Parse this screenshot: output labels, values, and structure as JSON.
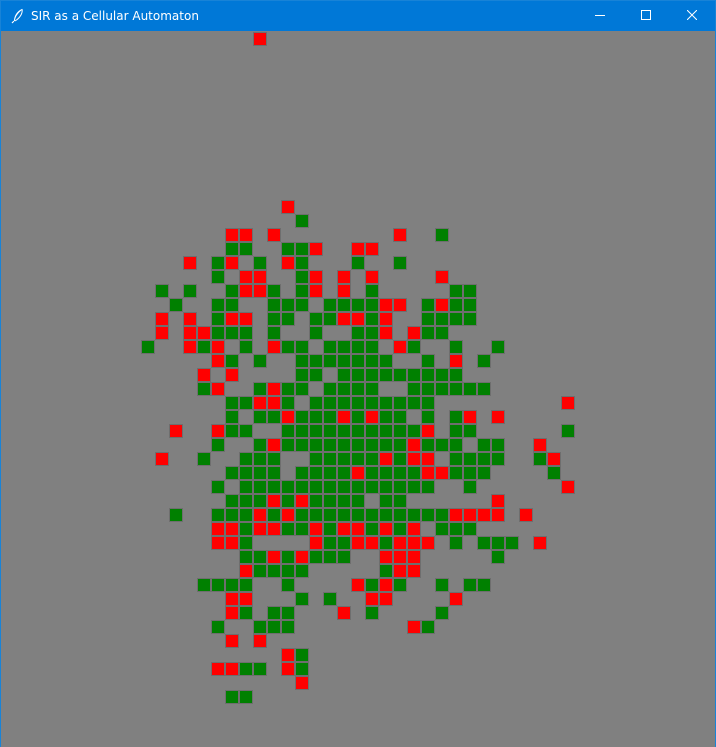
{
  "window": {
    "title": "SIR as a Cellular Automaton",
    "icon": "feather-icon",
    "controls": [
      "minimize-icon",
      "maximize-icon",
      "close-icon"
    ]
  },
  "colors": {
    "background": "#808080",
    "infected": "#ff0000",
    "recovered": "#008000",
    "titlebar": "#0078d7"
  },
  "grid": {
    "infected": [
      [
        19,
        0
      ],
      [
        21,
        12
      ],
      [
        17,
        14
      ],
      [
        18,
        14
      ],
      [
        20,
        14
      ],
      [
        29,
        14
      ],
      [
        23,
        15
      ],
      [
        26,
        15
      ],
      [
        27,
        15
      ],
      [
        14,
        16
      ],
      [
        17,
        16
      ],
      [
        21,
        16
      ],
      [
        18,
        17
      ],
      [
        19,
        17
      ],
      [
        23,
        17
      ],
      [
        25,
        17
      ],
      [
        27,
        17
      ],
      [
        32,
        17
      ],
      [
        18,
        18
      ],
      [
        19,
        18
      ],
      [
        23,
        18
      ],
      [
        25,
        18
      ],
      [
        28,
        19
      ],
      [
        29,
        19
      ],
      [
        32,
        19
      ],
      [
        12,
        20
      ],
      [
        14,
        20
      ],
      [
        17,
        20
      ],
      [
        18,
        20
      ],
      [
        25,
        20
      ],
      [
        26,
        20
      ],
      [
        28,
        20
      ],
      [
        12,
        21
      ],
      [
        14,
        21
      ],
      [
        15,
        21
      ],
      [
        28,
        21
      ],
      [
        30,
        21
      ],
      [
        14,
        22
      ],
      [
        16,
        22
      ],
      [
        20,
        22
      ],
      [
        29,
        22
      ],
      [
        16,
        23
      ],
      [
        33,
        23
      ],
      [
        15,
        24
      ],
      [
        17,
        24
      ],
      [
        16,
        25
      ],
      [
        20,
        25
      ],
      [
        19,
        26
      ],
      [
        20,
        26
      ],
      [
        41,
        26
      ],
      [
        21,
        27
      ],
      [
        25,
        27
      ],
      [
        27,
        27
      ],
      [
        34,
        27
      ],
      [
        36,
        27
      ],
      [
        13,
        28
      ],
      [
        16,
        28
      ],
      [
        31,
        28
      ],
      [
        20,
        29
      ],
      [
        30,
        29
      ],
      [
        39,
        29
      ],
      [
        12,
        30
      ],
      [
        28,
        30
      ],
      [
        30,
        30
      ],
      [
        31,
        30
      ],
      [
        40,
        30
      ],
      [
        26,
        31
      ],
      [
        31,
        31
      ],
      [
        32,
        31
      ],
      [
        41,
        32
      ],
      [
        20,
        33
      ],
      [
        22,
        33
      ],
      [
        36,
        33
      ],
      [
        19,
        34
      ],
      [
        21,
        34
      ],
      [
        33,
        34
      ],
      [
        34,
        34
      ],
      [
        35,
        34
      ],
      [
        36,
        34
      ],
      [
        38,
        34
      ],
      [
        16,
        35
      ],
      [
        17,
        35
      ],
      [
        19,
        35
      ],
      [
        20,
        35
      ],
      [
        23,
        35
      ],
      [
        25,
        35
      ],
      [
        26,
        35
      ],
      [
        28,
        35
      ],
      [
        30,
        35
      ],
      [
        16,
        36
      ],
      [
        17,
        36
      ],
      [
        23,
        36
      ],
      [
        26,
        36
      ],
      [
        27,
        36
      ],
      [
        29,
        36
      ],
      [
        30,
        36
      ],
      [
        31,
        36
      ],
      [
        39,
        36
      ],
      [
        20,
        37
      ],
      [
        22,
        37
      ],
      [
        28,
        37
      ],
      [
        29,
        37
      ],
      [
        30,
        37
      ],
      [
        18,
        38
      ],
      [
        29,
        38
      ],
      [
        30,
        38
      ],
      [
        26,
        39
      ],
      [
        28,
        39
      ],
      [
        17,
        40
      ],
      [
        18,
        40
      ],
      [
        27,
        40
      ],
      [
        28,
        40
      ],
      [
        33,
        40
      ],
      [
        17,
        41
      ],
      [
        25,
        41
      ],
      [
        30,
        42
      ],
      [
        17,
        43
      ],
      [
        19,
        43
      ],
      [
        21,
        44
      ],
      [
        16,
        45
      ],
      [
        17,
        45
      ],
      [
        21,
        45
      ],
      [
        22,
        46
      ]
    ],
    "recovered": [
      [
        22,
        13
      ],
      [
        32,
        14
      ],
      [
        17,
        15
      ],
      [
        18,
        15
      ],
      [
        21,
        15
      ],
      [
        22,
        15
      ],
      [
        16,
        16
      ],
      [
        19,
        16
      ],
      [
        22,
        16
      ],
      [
        26,
        16
      ],
      [
        29,
        16
      ],
      [
        16,
        17
      ],
      [
        22,
        17
      ],
      [
        12,
        18
      ],
      [
        14,
        18
      ],
      [
        17,
        18
      ],
      [
        20,
        18
      ],
      [
        22,
        18
      ],
      [
        27,
        18
      ],
      [
        33,
        18
      ],
      [
        34,
        18
      ],
      [
        13,
        19
      ],
      [
        16,
        19
      ],
      [
        17,
        19
      ],
      [
        20,
        19
      ],
      [
        21,
        19
      ],
      [
        22,
        19
      ],
      [
        24,
        19
      ],
      [
        25,
        19
      ],
      [
        26,
        19
      ],
      [
        27,
        19
      ],
      [
        31,
        19
      ],
      [
        33,
        19
      ],
      [
        34,
        19
      ],
      [
        16,
        20
      ],
      [
        20,
        20
      ],
      [
        21,
        20
      ],
      [
        23,
        20
      ],
      [
        24,
        20
      ],
      [
        27,
        20
      ],
      [
        31,
        20
      ],
      [
        32,
        20
      ],
      [
        33,
        20
      ],
      [
        34,
        20
      ],
      [
        16,
        21
      ],
      [
        17,
        21
      ],
      [
        18,
        21
      ],
      [
        20,
        21
      ],
      [
        23,
        21
      ],
      [
        26,
        21
      ],
      [
        27,
        21
      ],
      [
        31,
        21
      ],
      [
        32,
        21
      ],
      [
        11,
        22
      ],
      [
        15,
        22
      ],
      [
        18,
        22
      ],
      [
        21,
        22
      ],
      [
        22,
        22
      ],
      [
        24,
        22
      ],
      [
        25,
        22
      ],
      [
        26,
        22
      ],
      [
        27,
        22
      ],
      [
        30,
        22
      ],
      [
        33,
        22
      ],
      [
        36,
        22
      ],
      [
        17,
        23
      ],
      [
        19,
        23
      ],
      [
        22,
        23
      ],
      [
        23,
        23
      ],
      [
        24,
        23
      ],
      [
        25,
        23
      ],
      [
        26,
        23
      ],
      [
        27,
        23
      ],
      [
        28,
        23
      ],
      [
        31,
        23
      ],
      [
        35,
        23
      ],
      [
        22,
        24
      ],
      [
        23,
        24
      ],
      [
        25,
        24
      ],
      [
        26,
        24
      ],
      [
        27,
        24
      ],
      [
        28,
        24
      ],
      [
        29,
        24
      ],
      [
        30,
        24
      ],
      [
        31,
        24
      ],
      [
        32,
        24
      ],
      [
        33,
        24
      ],
      [
        15,
        25
      ],
      [
        19,
        25
      ],
      [
        21,
        25
      ],
      [
        22,
        25
      ],
      [
        24,
        25
      ],
      [
        25,
        25
      ],
      [
        26,
        25
      ],
      [
        27,
        25
      ],
      [
        30,
        25
      ],
      [
        31,
        25
      ],
      [
        32,
        25
      ],
      [
        33,
        25
      ],
      [
        34,
        25
      ],
      [
        35,
        25
      ],
      [
        17,
        26
      ],
      [
        18,
        26
      ],
      [
        21,
        26
      ],
      [
        23,
        26
      ],
      [
        24,
        26
      ],
      [
        25,
        26
      ],
      [
        26,
        26
      ],
      [
        27,
        26
      ],
      [
        28,
        26
      ],
      [
        29,
        26
      ],
      [
        30,
        26
      ],
      [
        31,
        26
      ],
      [
        17,
        27
      ],
      [
        19,
        27
      ],
      [
        20,
        27
      ],
      [
        22,
        27
      ],
      [
        23,
        27
      ],
      [
        24,
        27
      ],
      [
        26,
        27
      ],
      [
        28,
        27
      ],
      [
        29,
        27
      ],
      [
        31,
        27
      ],
      [
        33,
        27
      ],
      [
        17,
        28
      ],
      [
        18,
        28
      ],
      [
        21,
        28
      ],
      [
        22,
        28
      ],
      [
        23,
        28
      ],
      [
        24,
        28
      ],
      [
        25,
        28
      ],
      [
        26,
        28
      ],
      [
        27,
        28
      ],
      [
        28,
        28
      ],
      [
        29,
        28
      ],
      [
        30,
        28
      ],
      [
        33,
        28
      ],
      [
        34,
        28
      ],
      [
        41,
        28
      ],
      [
        16,
        29
      ],
      [
        19,
        29
      ],
      [
        21,
        29
      ],
      [
        22,
        29
      ],
      [
        23,
        29
      ],
      [
        24,
        29
      ],
      [
        25,
        29
      ],
      [
        26,
        29
      ],
      [
        27,
        29
      ],
      [
        28,
        29
      ],
      [
        29,
        29
      ],
      [
        31,
        29
      ],
      [
        32,
        29
      ],
      [
        33,
        29
      ],
      [
        35,
        29
      ],
      [
        36,
        29
      ],
      [
        15,
        30
      ],
      [
        18,
        30
      ],
      [
        19,
        30
      ],
      [
        20,
        30
      ],
      [
        23,
        30
      ],
      [
        24,
        30
      ],
      [
        25,
        30
      ],
      [
        26,
        30
      ],
      [
        27,
        30
      ],
      [
        29,
        30
      ],
      [
        33,
        30
      ],
      [
        34,
        30
      ],
      [
        35,
        30
      ],
      [
        36,
        30
      ],
      [
        39,
        30
      ],
      [
        17,
        31
      ],
      [
        18,
        31
      ],
      [
        19,
        31
      ],
      [
        20,
        31
      ],
      [
        22,
        31
      ],
      [
        23,
        31
      ],
      [
        24,
        31
      ],
      [
        25,
        31
      ],
      [
        27,
        31
      ],
      [
        28,
        31
      ],
      [
        29,
        31
      ],
      [
        30,
        31
      ],
      [
        33,
        31
      ],
      [
        34,
        31
      ],
      [
        35,
        31
      ],
      [
        40,
        31
      ],
      [
        16,
        32
      ],
      [
        18,
        32
      ],
      [
        19,
        32
      ],
      [
        20,
        32
      ],
      [
        21,
        32
      ],
      [
        22,
        32
      ],
      [
        23,
        32
      ],
      [
        24,
        32
      ],
      [
        25,
        32
      ],
      [
        26,
        32
      ],
      [
        27,
        32
      ],
      [
        28,
        32
      ],
      [
        29,
        32
      ],
      [
        30,
        32
      ],
      [
        31,
        32
      ],
      [
        34,
        32
      ],
      [
        17,
        33
      ],
      [
        18,
        33
      ],
      [
        19,
        33
      ],
      [
        21,
        33
      ],
      [
        23,
        33
      ],
      [
        24,
        33
      ],
      [
        25,
        33
      ],
      [
        26,
        33
      ],
      [
        28,
        33
      ],
      [
        29,
        33
      ],
      [
        13,
        34
      ],
      [
        16,
        34
      ],
      [
        17,
        34
      ],
      [
        18,
        34
      ],
      [
        20,
        34
      ],
      [
        22,
        34
      ],
      [
        23,
        34
      ],
      [
        24,
        34
      ],
      [
        25,
        34
      ],
      [
        26,
        34
      ],
      [
        27,
        34
      ],
      [
        28,
        34
      ],
      [
        29,
        34
      ],
      [
        30,
        34
      ],
      [
        31,
        34
      ],
      [
        32,
        34
      ],
      [
        18,
        35
      ],
      [
        21,
        35
      ],
      [
        22,
        35
      ],
      [
        24,
        35
      ],
      [
        27,
        35
      ],
      [
        29,
        35
      ],
      [
        32,
        35
      ],
      [
        33,
        35
      ],
      [
        34,
        35
      ],
      [
        18,
        36
      ],
      [
        24,
        36
      ],
      [
        25,
        36
      ],
      [
        28,
        36
      ],
      [
        33,
        36
      ],
      [
        35,
        36
      ],
      [
        36,
        36
      ],
      [
        37,
        36
      ],
      [
        18,
        37
      ],
      [
        19,
        37
      ],
      [
        21,
        37
      ],
      [
        23,
        37
      ],
      [
        24,
        37
      ],
      [
        25,
        37
      ],
      [
        36,
        37
      ],
      [
        19,
        38
      ],
      [
        20,
        38
      ],
      [
        21,
        38
      ],
      [
        22,
        38
      ],
      [
        28,
        38
      ],
      [
        15,
        39
      ],
      [
        16,
        39
      ],
      [
        17,
        39
      ],
      [
        18,
        39
      ],
      [
        21,
        39
      ],
      [
        27,
        39
      ],
      [
        29,
        39
      ],
      [
        32,
        39
      ],
      [
        34,
        39
      ],
      [
        35,
        39
      ],
      [
        18,
        40
      ],
      [
        22,
        40
      ],
      [
        24,
        40
      ],
      [
        18,
        41
      ],
      [
        20,
        41
      ],
      [
        21,
        41
      ],
      [
        27,
        41
      ],
      [
        32,
        41
      ],
      [
        16,
        42
      ],
      [
        19,
        42
      ],
      [
        20,
        42
      ],
      [
        21,
        42
      ],
      [
        31,
        42
      ],
      [
        22,
        44
      ],
      [
        18,
        45
      ],
      [
        19,
        45
      ],
      [
        22,
        45
      ],
      [
        17,
        47
      ],
      [
        18,
        47
      ]
    ]
  }
}
